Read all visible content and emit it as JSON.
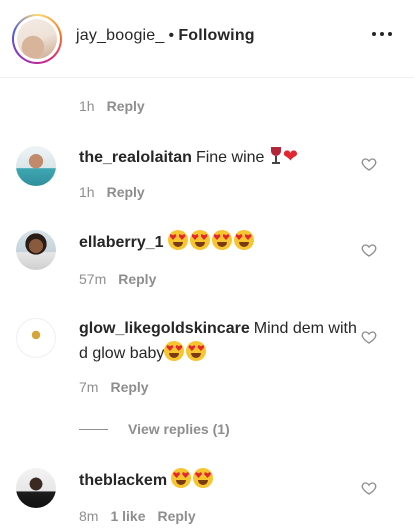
{
  "header": {
    "username": "jay_boogie_",
    "separator": "•",
    "follow_status": "Following"
  },
  "top_meta": {
    "time": "1h",
    "reply": "Reply"
  },
  "comments": [
    {
      "username": "the_realolaitan",
      "text": "Fine wine 🍷❤️",
      "time": "1h",
      "reply": "Reply"
    },
    {
      "username": "ellaberry_1",
      "text": "😍😍😍😍",
      "time": "57m",
      "reply": "Reply"
    },
    {
      "username": "glow_likegoldskincare",
      "text": "Mind dem with d glow baby😍😍",
      "time": "7m",
      "reply": "Reply",
      "view_replies": "View replies (1)"
    },
    {
      "username": "theblackem",
      "text": "😍😍",
      "time": "8m",
      "likes": "1 like",
      "reply": "Reply"
    }
  ],
  "icons": {
    "more": "more-options-icon",
    "like": "heart-outline-icon"
  },
  "colors": {
    "text": "#262626",
    "secondary": "#8e8e8e",
    "divider": "#efefef"
  }
}
